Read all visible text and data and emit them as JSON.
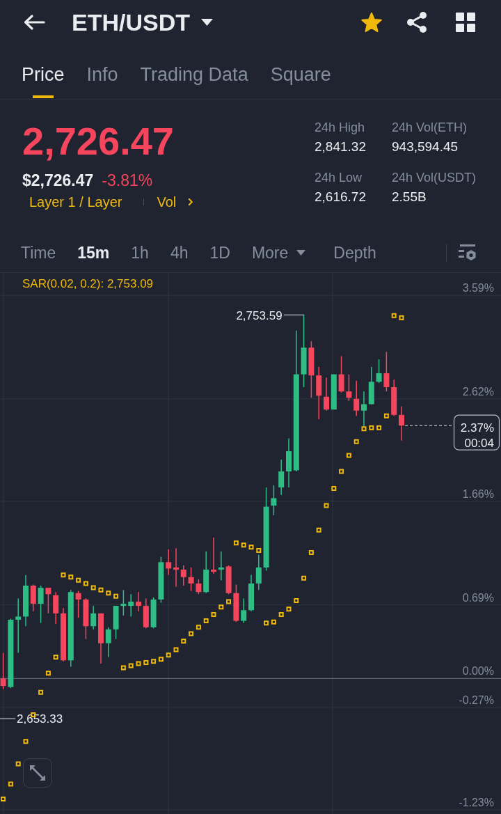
{
  "header": {
    "title": "ETH/USDT",
    "favorite": true
  },
  "tabs": [
    {
      "label": "Price",
      "selected": true
    },
    {
      "label": "Info",
      "selected": false
    },
    {
      "label": "Trading Data",
      "selected": false
    },
    {
      "label": "Square",
      "selected": false
    }
  ],
  "price": {
    "last": "2,726.47",
    "fiat": "$2,726.47",
    "change": "-3.81%",
    "down": true,
    "category": "Layer 1 / Layer",
    "volume_link": "Vol"
  },
  "stats": [
    {
      "label": "24h High",
      "value": "2,841.32"
    },
    {
      "label": "24h Vol(ETH)",
      "value": "943,594.45"
    },
    {
      "label": "24h Low",
      "value": "2,616.72"
    },
    {
      "label": "24h Vol(USDT)",
      "value": "2.55B"
    }
  ],
  "intervals": [
    {
      "label": "Time",
      "kind": "tab",
      "selected": false
    },
    {
      "label": "15m",
      "kind": "tab",
      "selected": true
    },
    {
      "label": "1h",
      "kind": "tab",
      "selected": false
    },
    {
      "label": "4h",
      "kind": "tab",
      "selected": false
    },
    {
      "label": "1D",
      "kind": "tab",
      "selected": false
    },
    {
      "label": "More",
      "kind": "dropdown",
      "selected": false
    },
    {
      "label": "Depth",
      "kind": "view",
      "selected": false
    }
  ],
  "chart": {
    "indicator": "SAR(0.02, 0.2): 2,753.09",
    "high_label": "2,753.59",
    "low_label": "2,653.33",
    "last_change": "2.37%",
    "countdown": "00:04",
    "chart_data": {
      "type": "candlestick",
      "ylim": [
        -1.27,
        3.8
      ],
      "grid": true,
      "categories": [
        null,
        null,
        null,
        null,
        null,
        null,
        null,
        null,
        null,
        null,
        null,
        null,
        null,
        null,
        null,
        null,
        null,
        null,
        null,
        null,
        null,
        null,
        null,
        null,
        null,
        null,
        null,
        null,
        null,
        null,
        null,
        null,
        null,
        null,
        null,
        null,
        null,
        null,
        null,
        null,
        null,
        null,
        null,
        null,
        null,
        null,
        null,
        null,
        null,
        null,
        null,
        null,
        null,
        null
      ],
      "yticks": [
        {
          "value": 3.59,
          "label": "3.59%"
        },
        {
          "value": 2.62,
          "label": "2.62%"
        },
        {
          "value": 1.66,
          "label": "1.66%"
        },
        {
          "value": 0.69,
          "label": "0.69%"
        },
        {
          "value": 0,
          "label": "0.00%"
        },
        {
          "value": -0.27,
          "label": "-0.27%"
        },
        {
          "value": -1.23,
          "label": "-1.23%"
        }
      ],
      "ohlc": [
        [
          0.0,
          0.24,
          -0.1,
          -0.07
        ],
        [
          -0.08,
          0.56,
          -0.09,
          0.55
        ],
        [
          0.55,
          0.75,
          0.24,
          0.58
        ],
        [
          0.58,
          0.97,
          0.49,
          0.87
        ],
        [
          0.87,
          0.88,
          0.63,
          0.7
        ],
        [
          0.7,
          0.87,
          0.52,
          0.85
        ],
        [
          0.85,
          0.85,
          0.61,
          0.79
        ],
        [
          0.78,
          0.81,
          0.51,
          0.61
        ],
        [
          0.61,
          0.66,
          0.16,
          0.17
        ],
        [
          0.17,
          0.83,
          0.11,
          0.81
        ],
        [
          0.8,
          0.82,
          0.57,
          0.74
        ],
        [
          0.74,
          0.75,
          0.37,
          0.49
        ],
        [
          0.49,
          0.68,
          0.46,
          0.61
        ],
        [
          0.61,
          0.61,
          0.14,
          0.33
        ],
        [
          0.33,
          0.48,
          0.2,
          0.46
        ],
        [
          0.46,
          0.68,
          0.37,
          0.68
        ],
        [
          0.68,
          0.83,
          0.59,
          0.7
        ],
        [
          0.68,
          0.79,
          0.58,
          0.72
        ],
        [
          0.72,
          0.81,
          0.63,
          0.68
        ],
        [
          0.68,
          0.75,
          0.47,
          0.48
        ],
        [
          0.48,
          0.76,
          0.47,
          0.74
        ],
        [
          0.74,
          1.14,
          0.71,
          1.09
        ],
        [
          1.09,
          1.21,
          0.97,
          1.03
        ],
        [
          1.04,
          1.22,
          0.86,
          1.02
        ],
        [
          1.02,
          1.06,
          0.87,
          0.95
        ],
        [
          0.95,
          1.04,
          0.82,
          0.89
        ],
        [
          0.89,
          0.93,
          0.79,
          0.81
        ],
        [
          0.81,
          1.19,
          0.8,
          1.02
        ],
        [
          1.02,
          1.32,
          0.98,
          1.0
        ],
        [
          1.02,
          1.19,
          0.92,
          1.04
        ],
        [
          1.05,
          1.06,
          0.79,
          0.8
        ],
        [
          0.8,
          0.88,
          0.53,
          0.54
        ],
        [
          0.54,
          0.75,
          0.52,
          0.64
        ],
        [
          0.64,
          0.97,
          0.63,
          0.89
        ],
        [
          0.89,
          1.16,
          0.83,
          1.04
        ],
        [
          1.04,
          1.79,
          1.01,
          1.61
        ],
        [
          1.62,
          1.81,
          1.53,
          1.69
        ],
        [
          1.79,
          2.05,
          1.72,
          1.94
        ],
        [
          1.94,
          2.25,
          1.79,
          2.13
        ],
        [
          1.95,
          3.26,
          1.94,
          2.85
        ],
        [
          2.85,
          3.41,
          2.73,
          3.1
        ],
        [
          3.1,
          3.16,
          2.63,
          2.84
        ],
        [
          2.84,
          2.92,
          2.43,
          2.65
        ],
        [
          2.64,
          2.82,
          2.51,
          2.52
        ],
        [
          2.52,
          2.85,
          2.52,
          2.85
        ],
        [
          2.85,
          3.02,
          2.68,
          2.69
        ],
        [
          2.69,
          2.85,
          2.6,
          2.63
        ],
        [
          2.62,
          2.79,
          2.46,
          2.51
        ],
        [
          2.51,
          2.69,
          2.36,
          2.57
        ],
        [
          2.57,
          2.92,
          2.57,
          2.78
        ],
        [
          2.78,
          2.99,
          2.77,
          2.86
        ],
        [
          2.86,
          3.06,
          2.69,
          2.73
        ],
        [
          2.73,
          2.8,
          2.46,
          2.47
        ],
        [
          2.47,
          2.55,
          2.23,
          2.37
        ]
      ]
    }
  }
}
